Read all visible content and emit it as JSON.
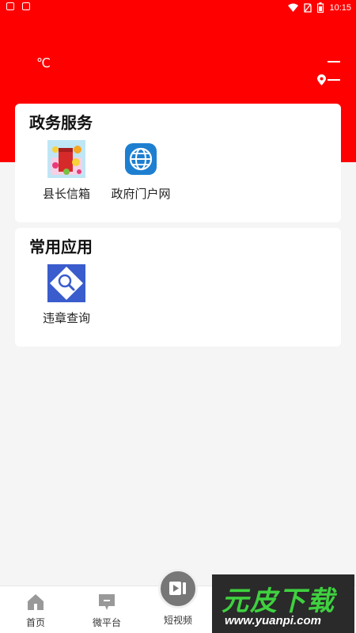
{
  "status_bar": {
    "time": "10:15"
  },
  "header": {
    "temperature": "℃"
  },
  "gov_services": {
    "title": "政务服务",
    "items": [
      {
        "label": "县长信箱",
        "icon": "mailbox-flowers-icon"
      },
      {
        "label": "政府门户网",
        "icon": "globe-icon"
      }
    ]
  },
  "common_apps": {
    "title": "常用应用",
    "items": [
      {
        "label": "违章查询",
        "icon": "search-icon"
      }
    ]
  },
  "bottom_nav": {
    "items": [
      {
        "label": "首页",
        "icon": "home-icon"
      },
      {
        "label": "微平台",
        "icon": "chat-icon"
      },
      {
        "label": "短视频",
        "icon": "video-icon"
      }
    ]
  },
  "watermark": {
    "title": "元皮下载",
    "url": "www.yuanpi.com"
  },
  "colors": {
    "header": "#ff0000",
    "globe_blue": "#1e7fd0",
    "search_blue": "#3a5ccc",
    "watermark_green": "#3fd13f"
  }
}
